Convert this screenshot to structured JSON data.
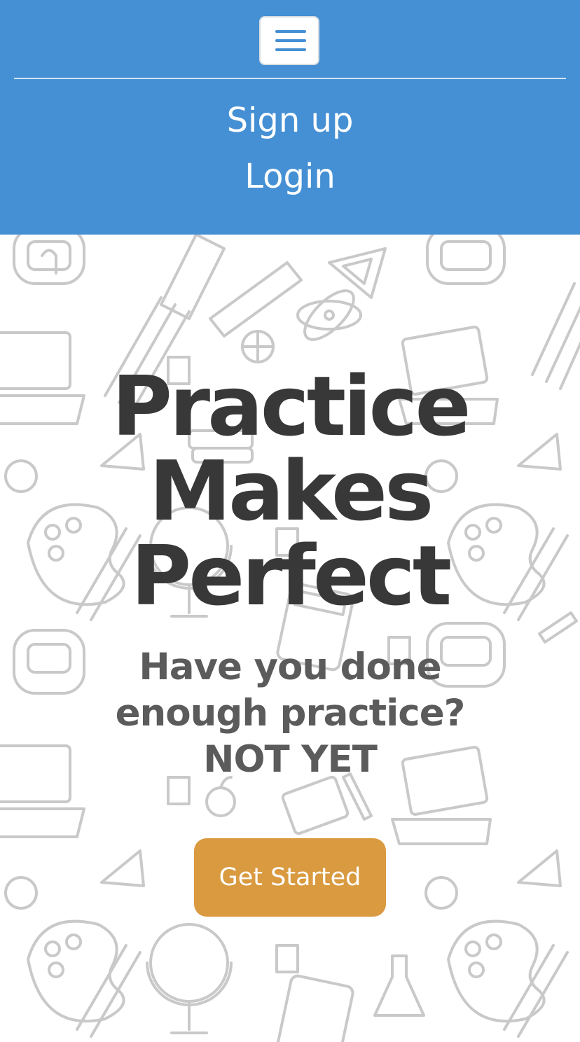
{
  "navbar": {
    "background": "#4590d4",
    "toggler_icon": "hamburger-menu-icon",
    "links": [
      {
        "label": "Sign up"
      },
      {
        "label": "Login"
      }
    ]
  },
  "hero": {
    "background_pattern": "school-doodle-pattern",
    "title_lines": [
      "Practice",
      "Makes",
      "Perfect"
    ],
    "subtitle_lines": [
      "Have you done",
      "enough practice?",
      "NOT YET"
    ],
    "cta_label": "Get Started",
    "cta_color": "#d99a40",
    "title_color": "#383838"
  }
}
